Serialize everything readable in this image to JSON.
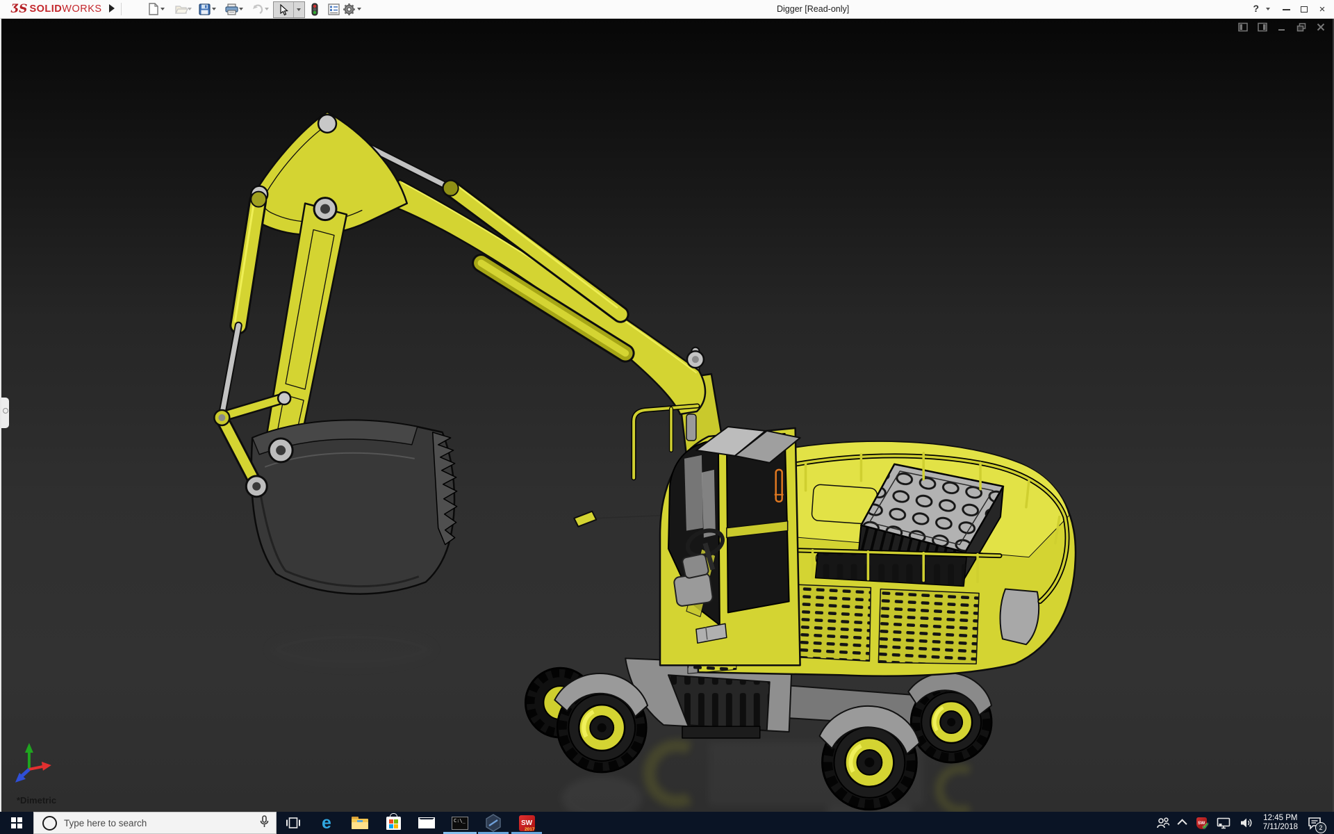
{
  "window": {
    "brand_ds": "ƷS",
    "brand_solid": "SOLID",
    "brand_works": "WORKS",
    "title": "Digger [Read-only]",
    "help_label": "?"
  },
  "toolbar": {
    "icons": [
      "new-document",
      "open",
      "save",
      "print",
      "undo",
      "select",
      "rebuild-traffic-light",
      "file-properties",
      "options-gear"
    ]
  },
  "viewport": {
    "orientation_label": "*Dimetric",
    "model_name": "Digger"
  },
  "taskbar": {
    "search_placeholder": "Type here to search",
    "edge_letter": "e",
    "terminal_text": "C:\\_",
    "sw_letters": "SW",
    "sw_badge_year": "2017",
    "tray": {
      "time": "12:45 PM",
      "date": "7/11/2018",
      "notification_count": "2"
    }
  },
  "colors": {
    "model_yellow": "#d4d432",
    "taskbar_bg": "#0a1425",
    "running_underline": "#6aa7dd",
    "titlebar_bg": "#fbfbfb",
    "triad_x": "#e23030",
    "triad_y": "#1fa51f",
    "triad_z": "#2f4fd8"
  }
}
